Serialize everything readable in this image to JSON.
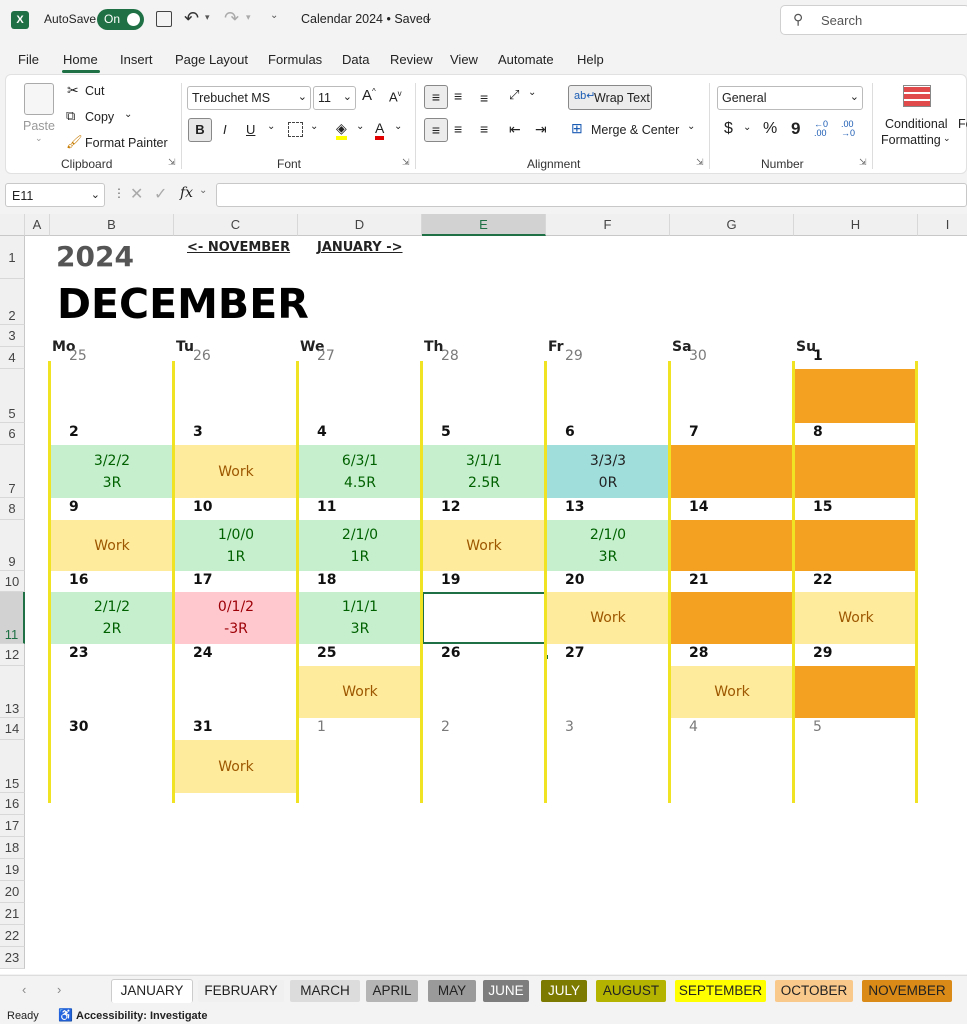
{
  "titlebar": {
    "autosave_label": "AutoSave",
    "toggle_label": "On",
    "doc_title": "Calendar 2024 • Saved",
    "search_placeholder": "Search"
  },
  "menu": [
    "File",
    "Home",
    "Insert",
    "Page Layout",
    "Formulas",
    "Data",
    "Review",
    "View",
    "Automate",
    "Help"
  ],
  "ribbon": {
    "clipboard": {
      "paste": "Paste",
      "cut": "Cut",
      "copy": "Copy",
      "format_painter": "Format Painter",
      "label": "Clipboard"
    },
    "font": {
      "name": "Trebuchet MS",
      "size": "11",
      "bold": "B",
      "italic": "I",
      "underline": "U",
      "label": "Font"
    },
    "alignment": {
      "wrap_text": "Wrap Text",
      "merge_center": "Merge & Center",
      "label": "Alignment"
    },
    "number": {
      "format": "General",
      "currency": "$",
      "percent": "%",
      "comma": "9",
      "inc_dec": "←0 .00",
      "dec_dec": ".00 →0",
      "label": "Number"
    },
    "styles": {
      "conditional": "Conditional",
      "formatting": "Formatting",
      "fo": "Fo"
    }
  },
  "formula": {
    "name_box": "E11",
    "fx": "fx",
    "value": ""
  },
  "columns": [
    "A",
    "B",
    "C",
    "D",
    "E",
    "F",
    "G",
    "H",
    "I"
  ],
  "rows": [
    "1",
    "2",
    "3",
    "4",
    "5",
    "6",
    "7",
    "8",
    "9",
    "10",
    "11",
    "12",
    "13",
    "14",
    "15",
    "16",
    "17",
    "18",
    "19",
    "20",
    "21",
    "22",
    "23"
  ],
  "calendar": {
    "year": "2024",
    "month": "DECEMBER",
    "prev_link": "<- NOVEMBER",
    "next_link": "JANUARY ->",
    "weekdays": [
      "Mo",
      "Tu",
      "We",
      "Th",
      "Fr",
      "Sa",
      "Su"
    ],
    "weeks": [
      {
        "days": [
          "25",
          "26",
          "27",
          "28",
          "29",
          "30",
          "1"
        ],
        "other": [
          true,
          true,
          true,
          true,
          true,
          true,
          false
        ],
        "cells": [
          null,
          null,
          null,
          null,
          null,
          null,
          {
            "type": "orange"
          }
        ]
      },
      {
        "days": [
          "2",
          "3",
          "4",
          "5",
          "6",
          "7",
          "8"
        ],
        "other": [
          false,
          false,
          false,
          false,
          false,
          false,
          false
        ],
        "cells": [
          {
            "type": "green",
            "l1": "3/2/2",
            "l2": "3R"
          },
          {
            "type": "work",
            "l1": "Work"
          },
          {
            "type": "green",
            "l1": "6/3/1",
            "l2": "4.5R"
          },
          {
            "type": "green",
            "l1": "3/1/1",
            "l2": "2.5R"
          },
          {
            "type": "teal",
            "l1": "3/3/3",
            "l2": "0R"
          },
          {
            "type": "orange"
          },
          {
            "type": "orange"
          }
        ]
      },
      {
        "days": [
          "9",
          "10",
          "11",
          "12",
          "13",
          "14",
          "15"
        ],
        "other": [
          false,
          false,
          false,
          false,
          false,
          false,
          false
        ],
        "cells": [
          {
            "type": "work",
            "l1": "Work"
          },
          {
            "type": "green",
            "l1": "1/0/0",
            "l2": "1R"
          },
          {
            "type": "green",
            "l1": "2/1/0",
            "l2": "1R"
          },
          {
            "type": "work",
            "l1": "Work"
          },
          {
            "type": "green",
            "l1": "2/1/0",
            "l2": "3R"
          },
          {
            "type": "orange"
          },
          {
            "type": "orange"
          }
        ]
      },
      {
        "days": [
          "16",
          "17",
          "18",
          "19",
          "20",
          "21",
          "22"
        ],
        "other": [
          false,
          false,
          false,
          false,
          false,
          false,
          false
        ],
        "cells": [
          {
            "type": "green",
            "l1": "2/1/2",
            "l2": "2R"
          },
          {
            "type": "red",
            "l1": "0/1/2",
            "l2": "-3R"
          },
          {
            "type": "green",
            "l1": "1/1/1",
            "l2": "3R"
          },
          {
            "type": "selected"
          },
          {
            "type": "work",
            "l1": "Work"
          },
          {
            "type": "orange"
          },
          {
            "type": "work",
            "l1": "Work"
          }
        ]
      },
      {
        "days": [
          "23",
          "24",
          "25",
          "26",
          "27",
          "28",
          "29"
        ],
        "other": [
          false,
          false,
          false,
          false,
          false,
          false,
          false
        ],
        "cells": [
          null,
          null,
          {
            "type": "work",
            "l1": "Work"
          },
          null,
          null,
          {
            "type": "work",
            "l1": "Work"
          },
          {
            "type": "orange"
          }
        ]
      },
      {
        "days": [
          "30",
          "31",
          "1",
          "2",
          "3",
          "4",
          "5"
        ],
        "other": [
          false,
          false,
          true,
          true,
          true,
          true,
          true
        ],
        "cells": [
          null,
          {
            "type": "work",
            "l1": "Work"
          },
          null,
          null,
          null,
          null,
          null
        ]
      }
    ]
  },
  "sheet_tabs": [
    {
      "name": "JANUARY",
      "bg": "#ffffff",
      "fg": "#222222",
      "active": true
    },
    {
      "name": "FEBRUARY",
      "bg": "#f0f0f0",
      "fg": "#222222"
    },
    {
      "name": "MARCH",
      "bg": "#dcdcdc",
      "fg": "#222222"
    },
    {
      "name": "APRIL",
      "bg": "#b5b5b5",
      "fg": "#222222"
    },
    {
      "name": "MAY",
      "bg": "#9a9a9a",
      "fg": "#222222"
    },
    {
      "name": "JUNE",
      "bg": "#7d7d7d",
      "fg": "#ffffff"
    },
    {
      "name": "JULY",
      "bg": "#7c7a00",
      "fg": "#ffffff"
    },
    {
      "name": "AUGUST",
      "bg": "#b4b400",
      "fg": "#222222"
    },
    {
      "name": "SEPTEMBER",
      "bg": "#ffff00",
      "fg": "#222222"
    },
    {
      "name": "OCTOBER",
      "bg": "#f9c98c",
      "fg": "#222222"
    },
    {
      "name": "NOVEMBER",
      "bg": "#d98a17",
      "fg": "#222222"
    }
  ],
  "status": {
    "ready": "Ready",
    "accessibility": "Accessibility: Investigate"
  },
  "colors": {
    "green_bg": "#c6efce",
    "green_fg": "#006100",
    "work_bg": "#ffeb9c",
    "work_fg": "#9c5700",
    "red_bg": "#ffc7ce",
    "red_fg": "#9c0006",
    "teal_bg": "#a0dedc",
    "orange_bg": "#f4a020",
    "divider": "#f0e323",
    "excel_green": "#1f7145"
  }
}
